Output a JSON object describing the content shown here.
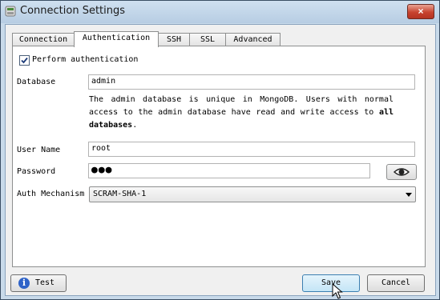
{
  "window": {
    "title": "Connection Settings",
    "close_label": "×"
  },
  "tabs": [
    {
      "label": "Connection",
      "active": false
    },
    {
      "label": "Authentication",
      "active": true
    },
    {
      "label": "SSH",
      "active": false
    },
    {
      "label": "SSL",
      "active": false
    },
    {
      "label": "Advanced",
      "active": false
    }
  ],
  "auth": {
    "perform_label": "Perform authentication",
    "perform_checked": true,
    "database_label": "Database",
    "database_value": "admin",
    "info_text_1": "The admin database is unique in MongoDB. Users with normal access to the admin database have read and write access to ",
    "info_text_bold": "all databases",
    "info_text_2": ".",
    "username_label": "User Name",
    "username_value": "root",
    "password_label": "Password",
    "password_value": "●●●",
    "mechanism_label": "Auth Mechanism",
    "mechanism_value": "SCRAM-SHA-1"
  },
  "buttons": {
    "test_label": "Test",
    "save_label": "Save",
    "cancel_label": "Cancel"
  },
  "icons": [
    "app-icon",
    "close-icon",
    "checkbox-check-icon",
    "eye-icon",
    "info-icon",
    "dropdown-arrow-icon",
    "mouse-cursor-icon"
  ],
  "colors": {
    "title_bar": "#c8daea",
    "close_button": "#c7432f",
    "info_icon": "#2f63c8"
  }
}
